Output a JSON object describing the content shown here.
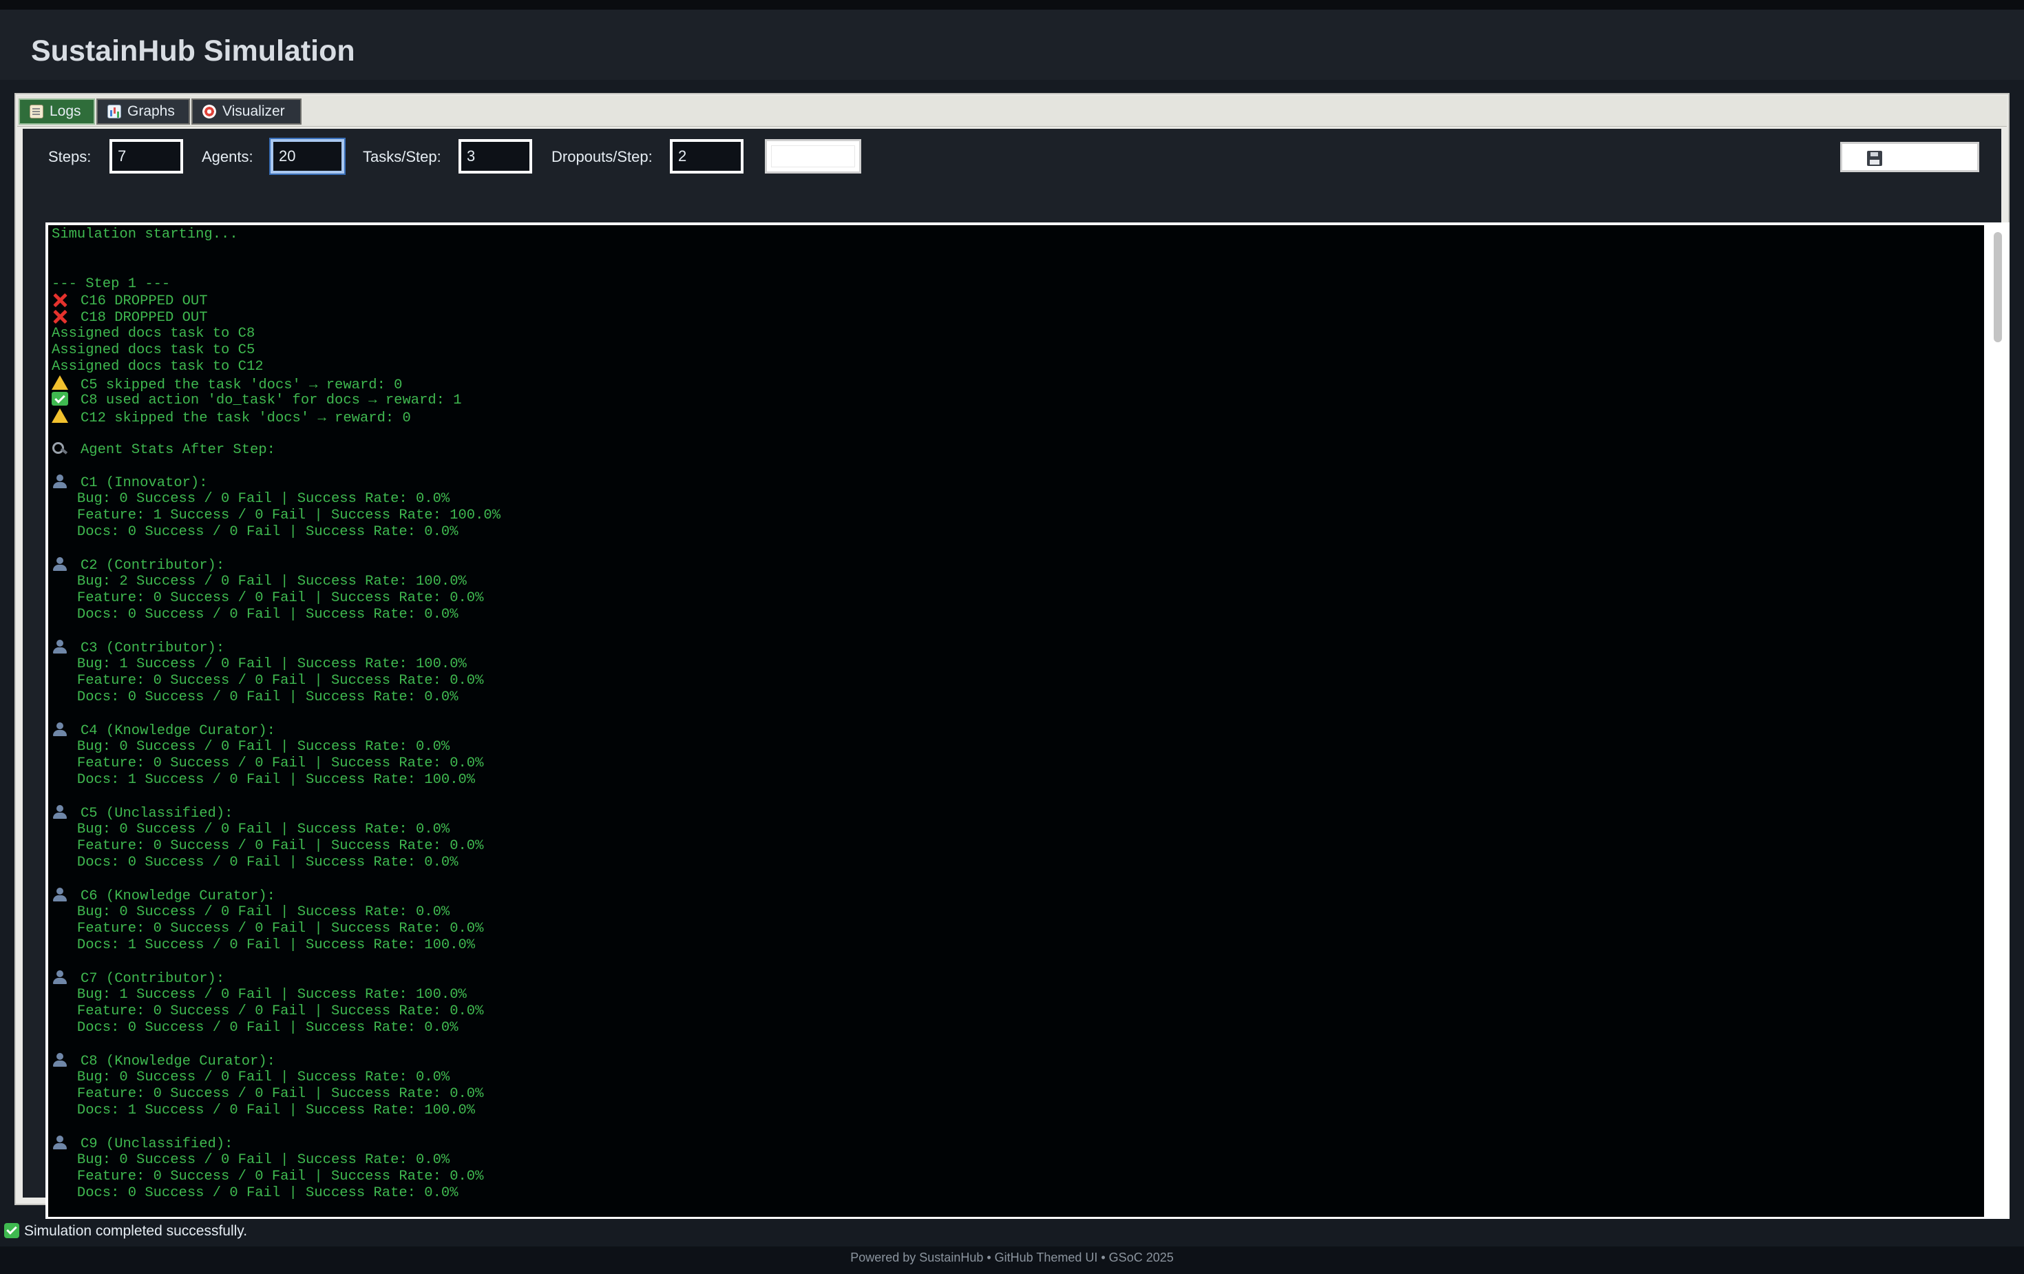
{
  "app": {
    "title": "SustainHub Simulation"
  },
  "tabs": [
    {
      "label": "Logs",
      "icon": "memo-icon",
      "active": true
    },
    {
      "label": "Graphs",
      "icon": "bar-chart-icon",
      "active": false
    },
    {
      "label": "Visualizer",
      "icon": "target-icon",
      "active": false
    }
  ],
  "controls": {
    "steps_label": "Steps:",
    "steps_value": "7",
    "agents_label": "Agents:",
    "agents_value": "20",
    "tasks_label": "Tasks/Step:",
    "tasks_value": "3",
    "dropouts_label": "Dropouts/Step:",
    "dropouts_value": "2",
    "save_icon": "floppy-disk-icon"
  },
  "log": {
    "text_color": "#3fb950",
    "lines": [
      {
        "text": "Simulation starting..."
      },
      {
        "text": ""
      },
      {
        "text": ""
      },
      {
        "text": "--- Step 1 ---"
      },
      {
        "icon": "cross",
        "text": "C16 DROPPED OUT"
      },
      {
        "icon": "cross",
        "text": "C18 DROPPED OUT"
      },
      {
        "text": "Assigned docs task to C8"
      },
      {
        "text": "Assigned docs task to C5"
      },
      {
        "text": "Assigned docs task to C12"
      },
      {
        "icon": "warn",
        "text": "C5 skipped the task 'docs' → reward: 0"
      },
      {
        "icon": "check",
        "text": "C8 used action 'do_task' for docs → reward: 1"
      },
      {
        "icon": "warn",
        "text": "C12 skipped the task 'docs' → reward: 0"
      },
      {
        "text": ""
      },
      {
        "icon": "mag",
        "text": "Agent Stats After Step:"
      },
      {
        "text": ""
      },
      {
        "icon": "user",
        "text": "C1 (Innovator):"
      },
      {
        "text": "   Bug: 0 Success / 0 Fail | Success Rate: 0.0%"
      },
      {
        "text": "   Feature: 1 Success / 0 Fail | Success Rate: 100.0%"
      },
      {
        "text": "   Docs: 0 Success / 0 Fail | Success Rate: 0.0%"
      },
      {
        "text": ""
      },
      {
        "icon": "user",
        "text": "C2 (Contributor):"
      },
      {
        "text": "   Bug: 2 Success / 0 Fail | Success Rate: 100.0%"
      },
      {
        "text": "   Feature: 0 Success / 0 Fail | Success Rate: 0.0%"
      },
      {
        "text": "   Docs: 0 Success / 0 Fail | Success Rate: 0.0%"
      },
      {
        "text": ""
      },
      {
        "icon": "user",
        "text": "C3 (Contributor):"
      },
      {
        "text": "   Bug: 1 Success / 0 Fail | Success Rate: 100.0%"
      },
      {
        "text": "   Feature: 0 Success / 0 Fail | Success Rate: 0.0%"
      },
      {
        "text": "   Docs: 0 Success / 0 Fail | Success Rate: 0.0%"
      },
      {
        "text": ""
      },
      {
        "icon": "user",
        "text": "C4 (Knowledge Curator):"
      },
      {
        "text": "   Bug: 0 Success / 0 Fail | Success Rate: 0.0%"
      },
      {
        "text": "   Feature: 0 Success / 0 Fail | Success Rate: 0.0%"
      },
      {
        "text": "   Docs: 1 Success / 0 Fail | Success Rate: 100.0%"
      },
      {
        "text": ""
      },
      {
        "icon": "user",
        "text": "C5 (Unclassified):"
      },
      {
        "text": "   Bug: 0 Success / 0 Fail | Success Rate: 0.0%"
      },
      {
        "text": "   Feature: 0 Success / 0 Fail | Success Rate: 0.0%"
      },
      {
        "text": "   Docs: 0 Success / 0 Fail | Success Rate: 0.0%"
      },
      {
        "text": ""
      },
      {
        "icon": "user",
        "text": "C6 (Knowledge Curator):"
      },
      {
        "text": "   Bug: 0 Success / 0 Fail | Success Rate: 0.0%"
      },
      {
        "text": "   Feature: 0 Success / 0 Fail | Success Rate: 0.0%"
      },
      {
        "text": "   Docs: 1 Success / 0 Fail | Success Rate: 100.0%"
      },
      {
        "text": ""
      },
      {
        "icon": "user",
        "text": "C7 (Contributor):"
      },
      {
        "text": "   Bug: 1 Success / 0 Fail | Success Rate: 100.0%"
      },
      {
        "text": "   Feature: 0 Success / 0 Fail | Success Rate: 0.0%"
      },
      {
        "text": "   Docs: 0 Success / 0 Fail | Success Rate: 0.0%"
      },
      {
        "text": ""
      },
      {
        "icon": "user",
        "text": "C8 (Knowledge Curator):"
      },
      {
        "text": "   Bug: 0 Success / 0 Fail | Success Rate: 0.0%"
      },
      {
        "text": "   Feature: 0 Success / 0 Fail | Success Rate: 0.0%"
      },
      {
        "text": "   Docs: 1 Success / 0 Fail | Success Rate: 100.0%"
      },
      {
        "text": ""
      },
      {
        "icon": "user",
        "text": "C9 (Unclassified):"
      },
      {
        "text": "   Bug: 0 Success / 0 Fail | Success Rate: 0.0%"
      },
      {
        "text": "   Feature: 0 Success / 0 Fail | Success Rate: 0.0%"
      },
      {
        "text": "   Docs: 0 Success / 0 Fail | Success Rate: 0.0%"
      }
    ]
  },
  "status": {
    "icon": "check-icon",
    "text": "Simulation completed successfully."
  },
  "footer": {
    "text": "Powered by SustainHub • GitHub Themed UI • GSoC 2025"
  }
}
